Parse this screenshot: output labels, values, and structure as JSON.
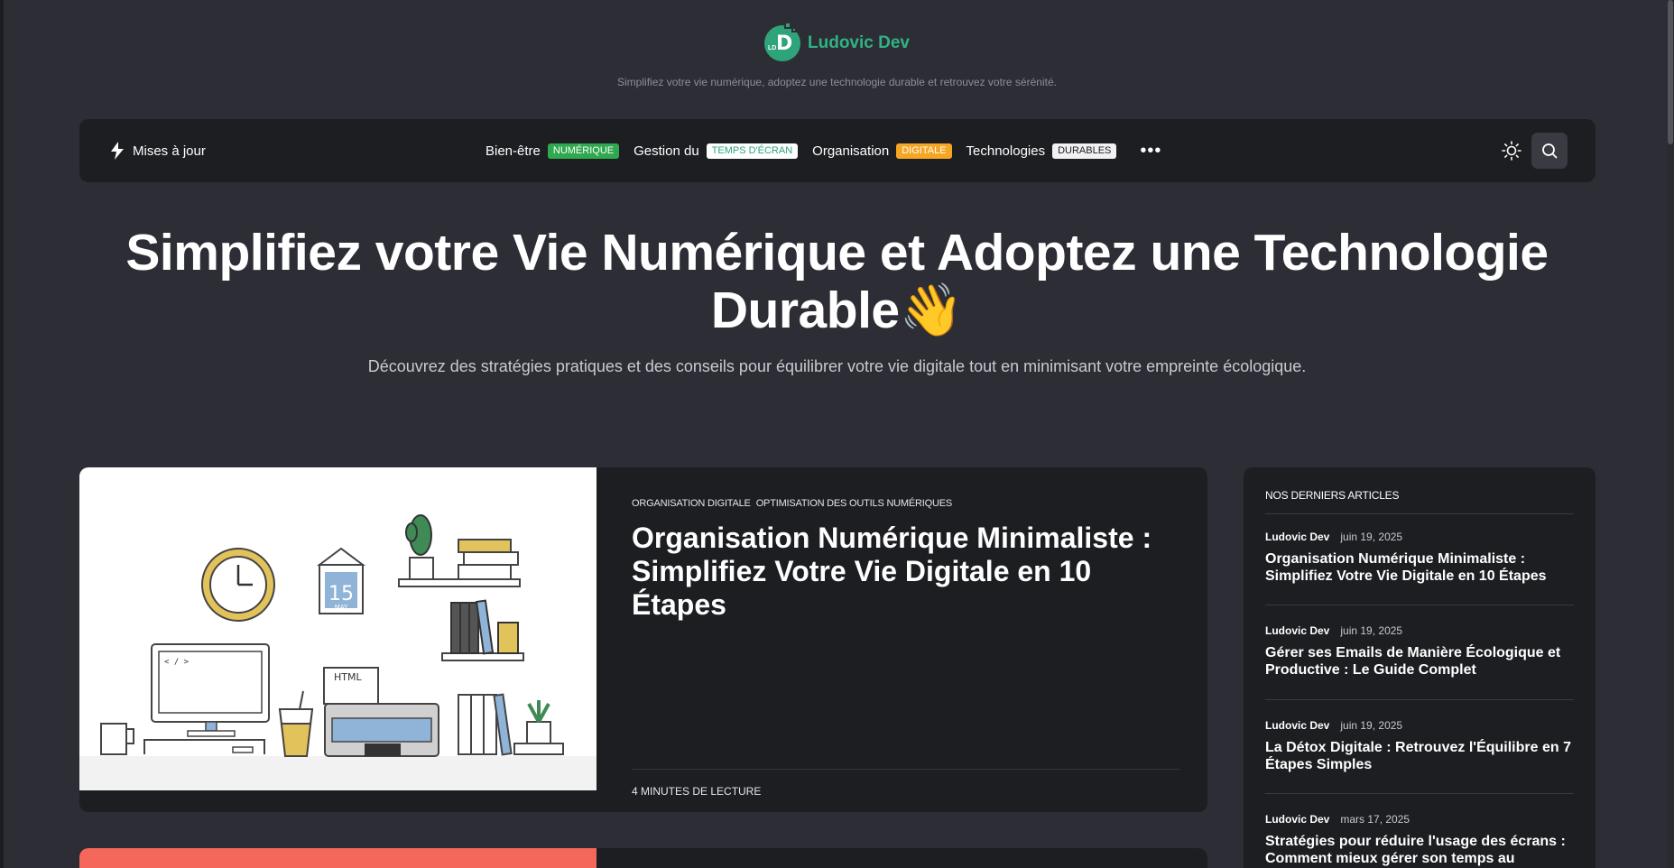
{
  "brand": {
    "name": "Ludovic Dev",
    "logo_small": "LD"
  },
  "tagline": "Simplifiez votre vie numérique, adoptez une technologie durable et retrouvez votre sérénité.",
  "nav": {
    "updates_label": "Mises à jour",
    "items": [
      {
        "label": "Bien-être",
        "badge": "NUMÉRIQUE",
        "badge_bg": "#2fa84f",
        "badge_fg": "#ffffff"
      },
      {
        "label": "Gestion du",
        "badge": "TEMPS D'ÉCRAN",
        "badge_bg": "#ffffff",
        "badge_fg": "#2fa37a"
      },
      {
        "label": "Organisation",
        "badge": "DIGITALE",
        "badge_bg": "#f5a623",
        "badge_fg": "#ffffff"
      },
      {
        "label": "Technologies",
        "badge": "DURABLES",
        "badge_bg": "#f1f1f3",
        "badge_fg": "#1d1e22"
      }
    ],
    "more": "•••",
    "icons": [
      "bolt-icon",
      "sun-icon",
      "search-icon"
    ]
  },
  "hero": {
    "title_line1": "Simplifiez votre Vie Numérique et Adoptez une Technologie",
    "title_line2": "Durable",
    "emoji": "👋",
    "subtitle": "Découvrez des stratégies pratiques et des conseils pour équilibrer votre vie digitale tout en minimisant votre empreinte écologique."
  },
  "featured": {
    "categories": [
      "ORGANISATION DIGITALE",
      "OPTIMISATION DES OUTILS NUMÉRIQUES"
    ],
    "title": "Organisation Numérique Minimaliste : Simplifiez Votre Vie Digitale en 10 Étapes",
    "read_time": "4 MINUTES DE LECTURE",
    "illustration": {
      "calendar_day": "15",
      "calendar_month": "MAY",
      "monitor_code": "< / >",
      "paper_label": "HTML"
    }
  },
  "sidebar": {
    "title": "NOS DERNIERS ARTICLES",
    "articles": [
      {
        "author": "Ludovic Dev",
        "date": "juin 19, 2025",
        "title": "Organisation Numérique Minimaliste : Simplifiez Votre Vie Digitale en 10 Étapes"
      },
      {
        "author": "Ludovic Dev",
        "date": "juin 19, 2025",
        "title": "Gérer ses Emails de Manière Écologique et Productive : Le Guide Complet"
      },
      {
        "author": "Ludovic Dev",
        "date": "juin 19, 2025",
        "title": "La Détox Digitale : Retrouvez l'Équilibre en 7 Étapes Simples"
      },
      {
        "author": "Ludovic Dev",
        "date": "mars 17, 2025",
        "title": "Stratégies pour réduire l'usage des écrans : Comment mieux gérer son temps au"
      }
    ]
  },
  "colors": {
    "background": "#2d2e35",
    "card": "#1d1e22",
    "accent": "#2fb384"
  }
}
